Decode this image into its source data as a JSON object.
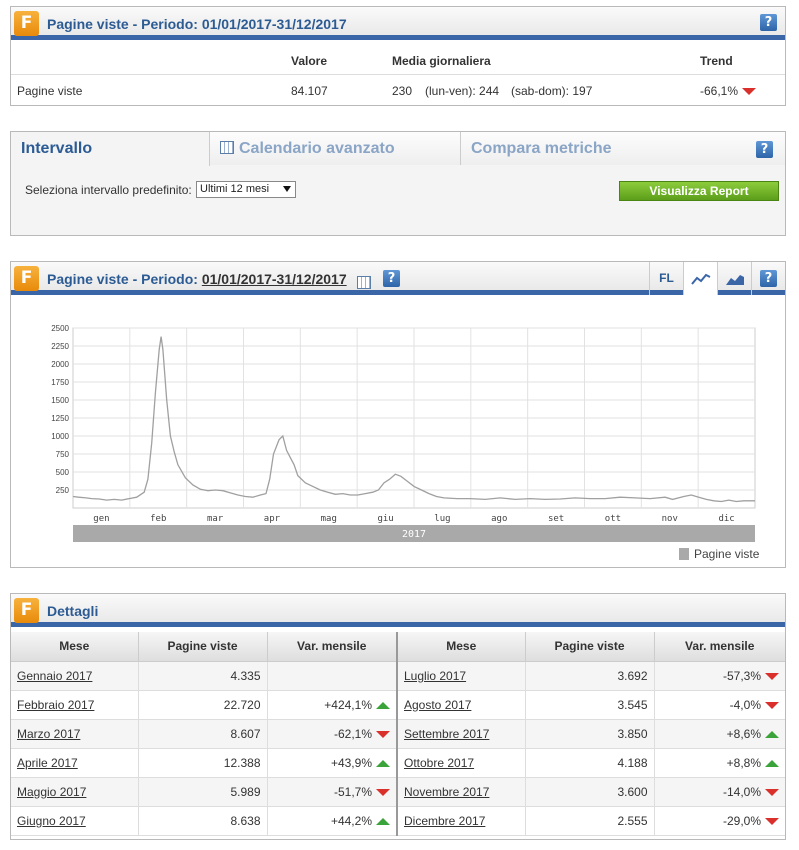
{
  "summary": {
    "title": "Pagine viste - Periodo: 01/01/2017-31/12/2017",
    "help": "?",
    "headers": {
      "valore": "Valore",
      "media": "Media giornaliera",
      "trend": "Trend"
    },
    "row": {
      "label": "Pagine viste",
      "valore": "84.107",
      "media": "230",
      "lunven": "(lun-ven): 244",
      "sabdom": "(sab-dom): 197",
      "trend": "-66,1%"
    }
  },
  "interval": {
    "tabs": [
      "Intervallo",
      "Calendario avanzato",
      "Compara metriche"
    ],
    "help": "?",
    "select_label": "Seleziona intervallo predefinito:",
    "select_value": "Ultimi 12 mesi",
    "button": "Visualizza Report"
  },
  "chart_panel": {
    "title_prefix": "Pagine viste - Periodo:",
    "title_period": "01/01/2017-31/12/2017",
    "help": "?",
    "fl_button": "FL",
    "legend": "Pagine viste",
    "year_label": "2017"
  },
  "chart_data": {
    "type": "line",
    "title": "",
    "xlabel": "",
    "ylabel": "",
    "ylim": [
      0,
      2500
    ],
    "yticks": [
      250,
      500,
      750,
      1000,
      1250,
      1500,
      1750,
      2000,
      2250,
      2500
    ],
    "month_labels": [
      "gen",
      "feb",
      "mar",
      "apr",
      "mag",
      "giu",
      "lug",
      "ago",
      "set",
      "ott",
      "nov",
      "dic"
    ],
    "grid": true,
    "legend_position": "bottom-right",
    "series": [
      {
        "name": "Pagine viste",
        "color": "#a0a0a0",
        "points": [
          [
            0,
            160
          ],
          [
            3,
            150
          ],
          [
            7,
            140
          ],
          [
            10,
            130
          ],
          [
            14,
            125
          ],
          [
            18,
            110
          ],
          [
            22,
            120
          ],
          [
            26,
            110
          ],
          [
            30,
            130
          ],
          [
            34,
            150
          ],
          [
            38,
            220
          ],
          [
            40,
            400
          ],
          [
            42,
            900
          ],
          [
            44,
            1600
          ],
          [
            46,
            2200
          ],
          [
            47,
            2380
          ],
          [
            48,
            2200
          ],
          [
            50,
            1500
          ],
          [
            52,
            1000
          ],
          [
            54,
            780
          ],
          [
            56,
            600
          ],
          [
            60,
            420
          ],
          [
            64,
            320
          ],
          [
            68,
            260
          ],
          [
            72,
            240
          ],
          [
            76,
            250
          ],
          [
            80,
            240
          ],
          [
            84,
            210
          ],
          [
            88,
            180
          ],
          [
            92,
            160
          ],
          [
            96,
            150
          ],
          [
            100,
            180
          ],
          [
            103,
            200
          ],
          [
            105,
            400
          ],
          [
            107,
            750
          ],
          [
            110,
            950
          ],
          [
            112,
            1000
          ],
          [
            114,
            800
          ],
          [
            116,
            700
          ],
          [
            118,
            600
          ],
          [
            120,
            450
          ],
          [
            124,
            350
          ],
          [
            128,
            300
          ],
          [
            132,
            250
          ],
          [
            136,
            220
          ],
          [
            140,
            190
          ],
          [
            144,
            200
          ],
          [
            148,
            180
          ],
          [
            152,
            180
          ],
          [
            156,
            200
          ],
          [
            160,
            220
          ],
          [
            163,
            250
          ],
          [
            166,
            350
          ],
          [
            169,
            400
          ],
          [
            172,
            470
          ],
          [
            175,
            440
          ],
          [
            178,
            380
          ],
          [
            182,
            300
          ],
          [
            186,
            250
          ],
          [
            190,
            200
          ],
          [
            194,
            160
          ],
          [
            198,
            140
          ],
          [
            205,
            130
          ],
          [
            212,
            130
          ],
          [
            220,
            120
          ],
          [
            228,
            140
          ],
          [
            236,
            120
          ],
          [
            244,
            130
          ],
          [
            252,
            120
          ],
          [
            260,
            125
          ],
          [
            268,
            140
          ],
          [
            276,
            130
          ],
          [
            284,
            130
          ],
          [
            292,
            150
          ],
          [
            300,
            140
          ],
          [
            308,
            130
          ],
          [
            316,
            150
          ],
          [
            320,
            120
          ],
          [
            326,
            160
          ],
          [
            330,
            180
          ],
          [
            334,
            150
          ],
          [
            338,
            120
          ],
          [
            342,
            100
          ],
          [
            346,
            90
          ],
          [
            350,
            110
          ],
          [
            354,
            90
          ],
          [
            358,
            100
          ],
          [
            364,
            100
          ]
        ]
      }
    ]
  },
  "details": {
    "title": "Dettagli",
    "headers": [
      "Mese",
      "Pagine viste",
      "Var. mensile",
      "Mese",
      "Pagine viste",
      "Var. mensile"
    ],
    "rows": [
      {
        "m1": "Gennaio 2017",
        "p1": "4.335",
        "v1": "",
        "t1": "none",
        "m2": "Luglio 2017",
        "p2": "3.692",
        "v2": "-57,3%",
        "t2": "down"
      },
      {
        "m1": "Febbraio 2017",
        "p1": "22.720",
        "v1": "+424,1%",
        "t1": "up",
        "m2": "Agosto 2017",
        "p2": "3.545",
        "v2": "-4,0%",
        "t2": "down"
      },
      {
        "m1": "Marzo 2017",
        "p1": "8.607",
        "v1": "-62,1%",
        "t1": "down",
        "m2": "Settembre 2017",
        "p2": "3.850",
        "v2": "+8,6%",
        "t2": "up"
      },
      {
        "m1": "Aprile 2017",
        "p1": "12.388",
        "v1": "+43,9%",
        "t1": "up",
        "m2": "Ottobre 2017",
        "p2": "4.188",
        "v2": "+8,8%",
        "t2": "up"
      },
      {
        "m1": "Maggio 2017",
        "p1": "5.989",
        "v1": "-51,7%",
        "t1": "down",
        "m2": "Novembre 2017",
        "p2": "3.600",
        "v2": "-14,0%",
        "t2": "down"
      },
      {
        "m1": "Giugno 2017",
        "p1": "8.638",
        "v1": "+44,2%",
        "t1": "up",
        "m2": "Dicembre 2017",
        "p2": "2.555",
        "v2": "-29,0%",
        "t2": "down"
      }
    ]
  },
  "colors": {
    "accent": "#3a66a8",
    "title": "#2c5b94",
    "down": "#d9302c",
    "up": "#3aa33a",
    "button": "#6fb12a"
  }
}
